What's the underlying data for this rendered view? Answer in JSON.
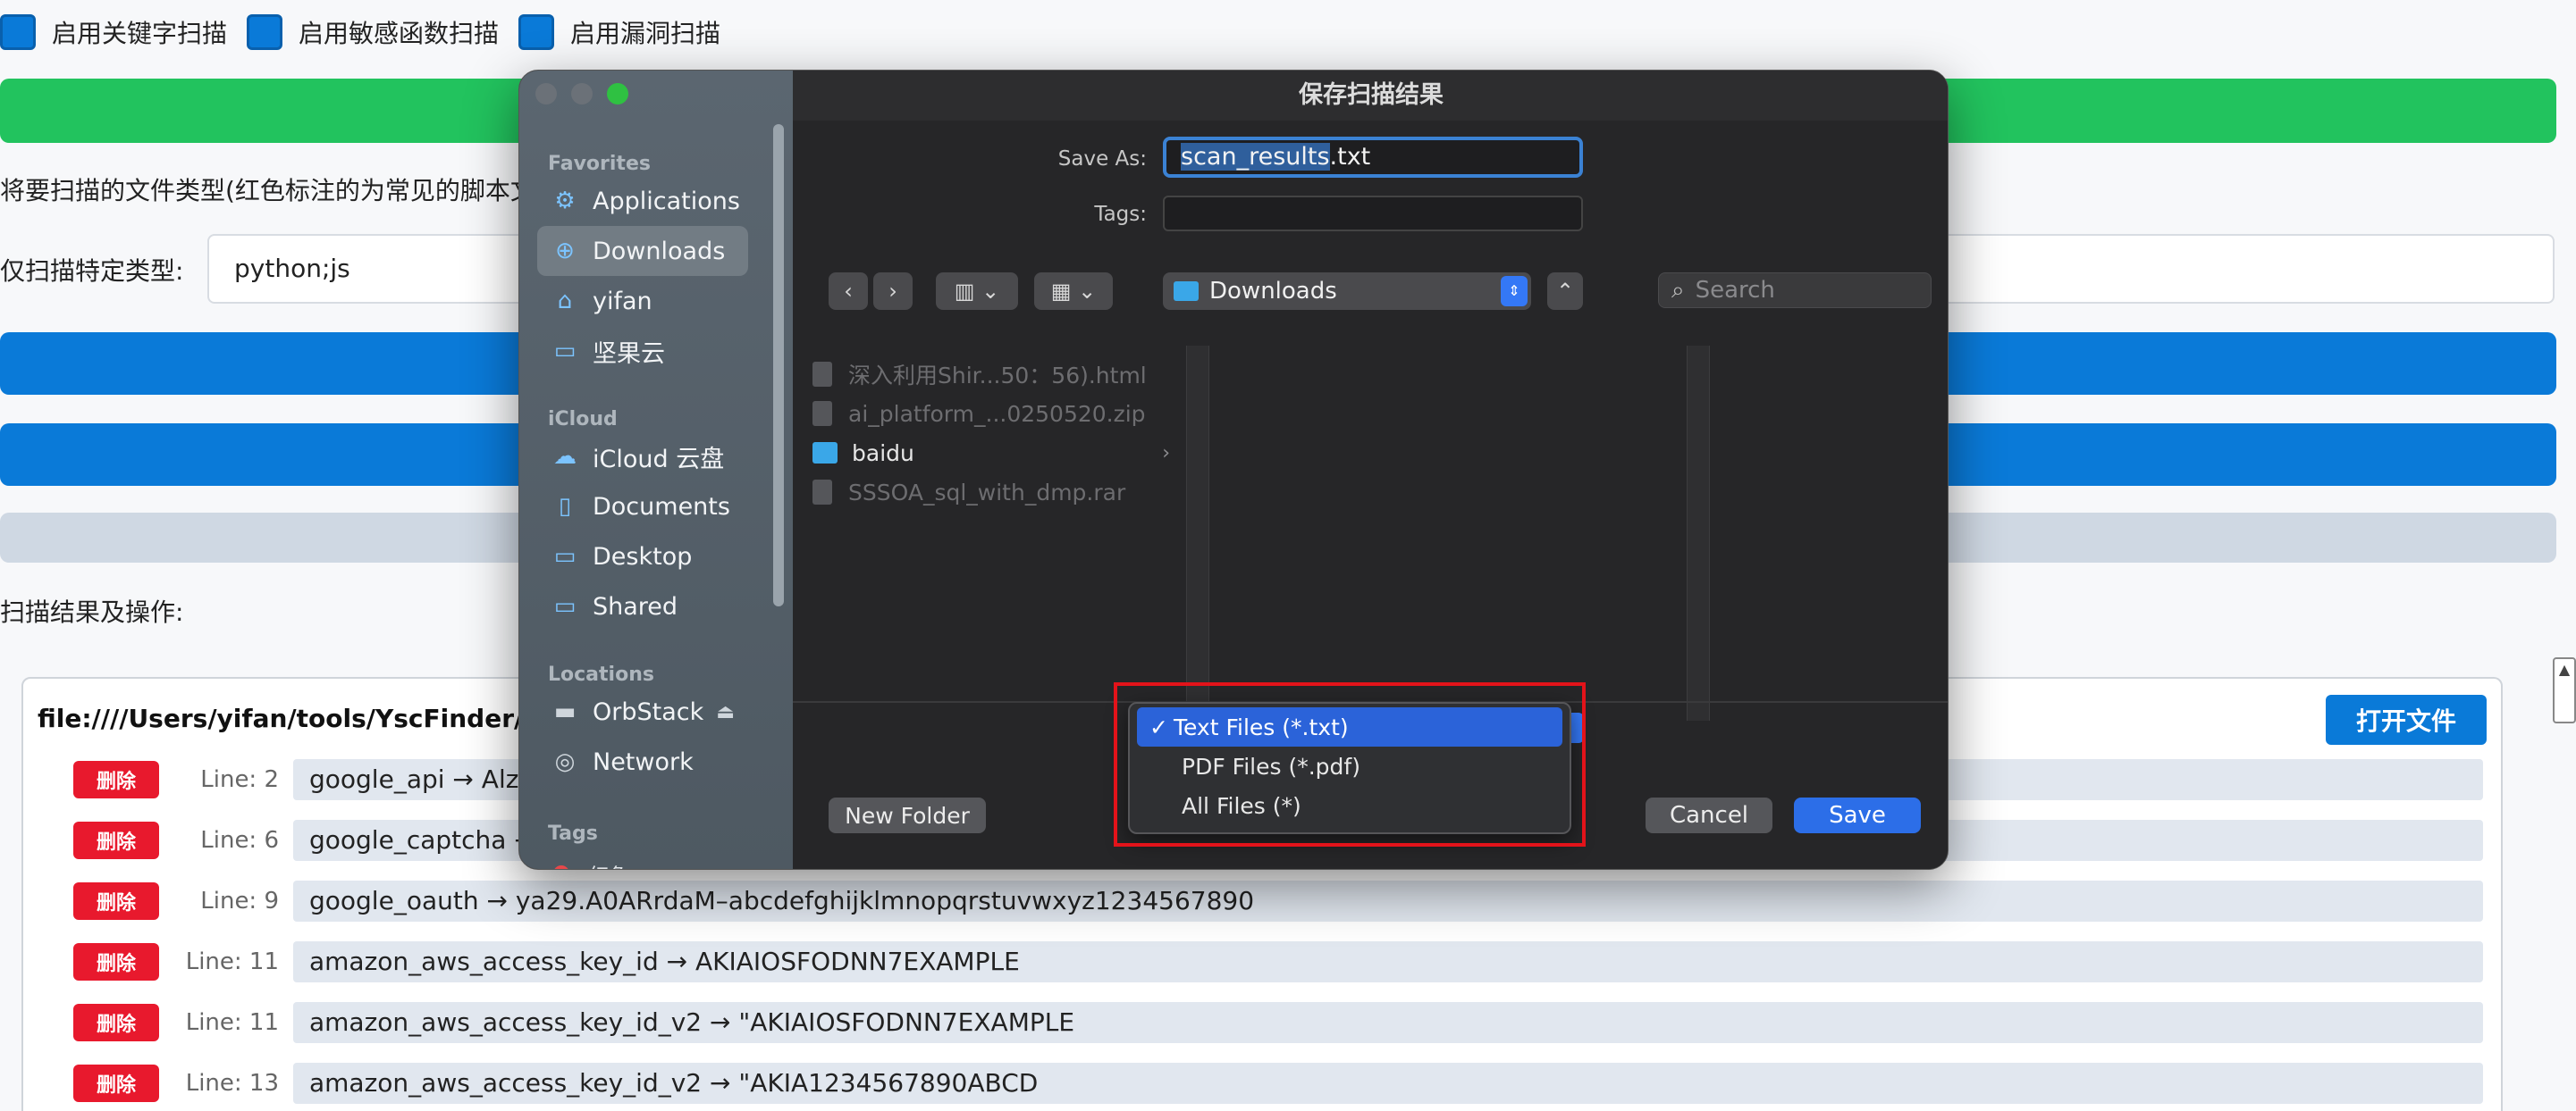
{
  "options": {
    "keyword_scan": "启用关键字扫描",
    "sensitive_func_scan": "启用敏感函数扫描",
    "vuln_scan": "启用漏洞扫描"
  },
  "filetype_label": "将要扫描的文件类型(红色标注的为常见的脚本文",
  "specific_type_label": "仅扫描特定类型:",
  "specific_type_value": "python;js",
  "results_label": "扫描结果及操作:",
  "results_file_path": "file:////Users/yifan/tools/YscFinder/tes",
  "open_file_button": "打开文件",
  "delete_label": "删除",
  "results": [
    {
      "line": "Line: 2",
      "text": "google_api → Alza"
    },
    {
      "line": "Line: 6",
      "text": "google_captcha →"
    },
    {
      "line": "Line: 9",
      "text": "google_oauth → ya29.A0ARrdaM–abcdefghijklmnopqrstuvwxyz1234567890"
    },
    {
      "line": "Line: 11",
      "text": "amazon_aws_access_key_id → AKIAIOSFODNN7EXAMPLE"
    },
    {
      "line": "Line: 11",
      "text": "amazon_aws_access_key_id_v2 → \"AKIAIOSFODNN7EXAMPLE"
    },
    {
      "line": "Line: 13",
      "text": "amazon_aws_access_key_id_v2 → \"AKIA1234567890ABCD"
    }
  ],
  "dialog": {
    "title": "保存扫描结果",
    "save_as_label": "Save As:",
    "save_as_value_selected": "scan_results",
    "save_as_value_ext": ".txt",
    "tags_label": "Tags:",
    "location": "Downloads",
    "search_placeholder": "Search",
    "sidebar": {
      "favorites_header": "Favorites",
      "favorites": [
        {
          "label": "Applications",
          "icon": "applications-icon"
        },
        {
          "label": "Downloads",
          "icon": "downloads-icon",
          "selected": true
        },
        {
          "label": "yifan",
          "icon": "home-icon"
        },
        {
          "label": "坚果云",
          "icon": "folder-icon"
        }
      ],
      "icloud_header": "iCloud",
      "icloud": [
        {
          "label": "iCloud 云盘",
          "icon": "cloud-icon"
        },
        {
          "label": "Documents",
          "icon": "document-icon"
        },
        {
          "label": "Desktop",
          "icon": "desktop-icon"
        },
        {
          "label": "Shared",
          "icon": "shared-folder-icon"
        }
      ],
      "locations_header": "Locations",
      "locations": [
        {
          "label": "OrbStack",
          "icon": "drive-icon"
        },
        {
          "label": "Network",
          "icon": "network-icon"
        }
      ],
      "tags_header": "Tags",
      "tag_partial": "红色"
    },
    "files": [
      {
        "name": "深入利用Shir...50：56).html",
        "type": "file"
      },
      {
        "name": "ai_platform_...0250520.zip",
        "type": "file"
      },
      {
        "name": "baidu",
        "type": "folder"
      },
      {
        "name": "SSSOA_sql_with_dmp.rar",
        "type": "file"
      }
    ],
    "new_folder_button": "New Folder",
    "cancel_button": "Cancel",
    "save_button": "Save",
    "format_options": [
      {
        "label": "Text Files (*.txt)",
        "selected": true
      },
      {
        "label": "PDF Files (*.pdf)",
        "selected": false
      },
      {
        "label": "All Files (*)",
        "selected": false
      }
    ]
  },
  "colors": {
    "accent_blue": "#0a7ad8",
    "green": "#22c35e",
    "delete_red": "#e8192d",
    "dialog_bg": "#262628",
    "highlight": "#e3131a"
  }
}
